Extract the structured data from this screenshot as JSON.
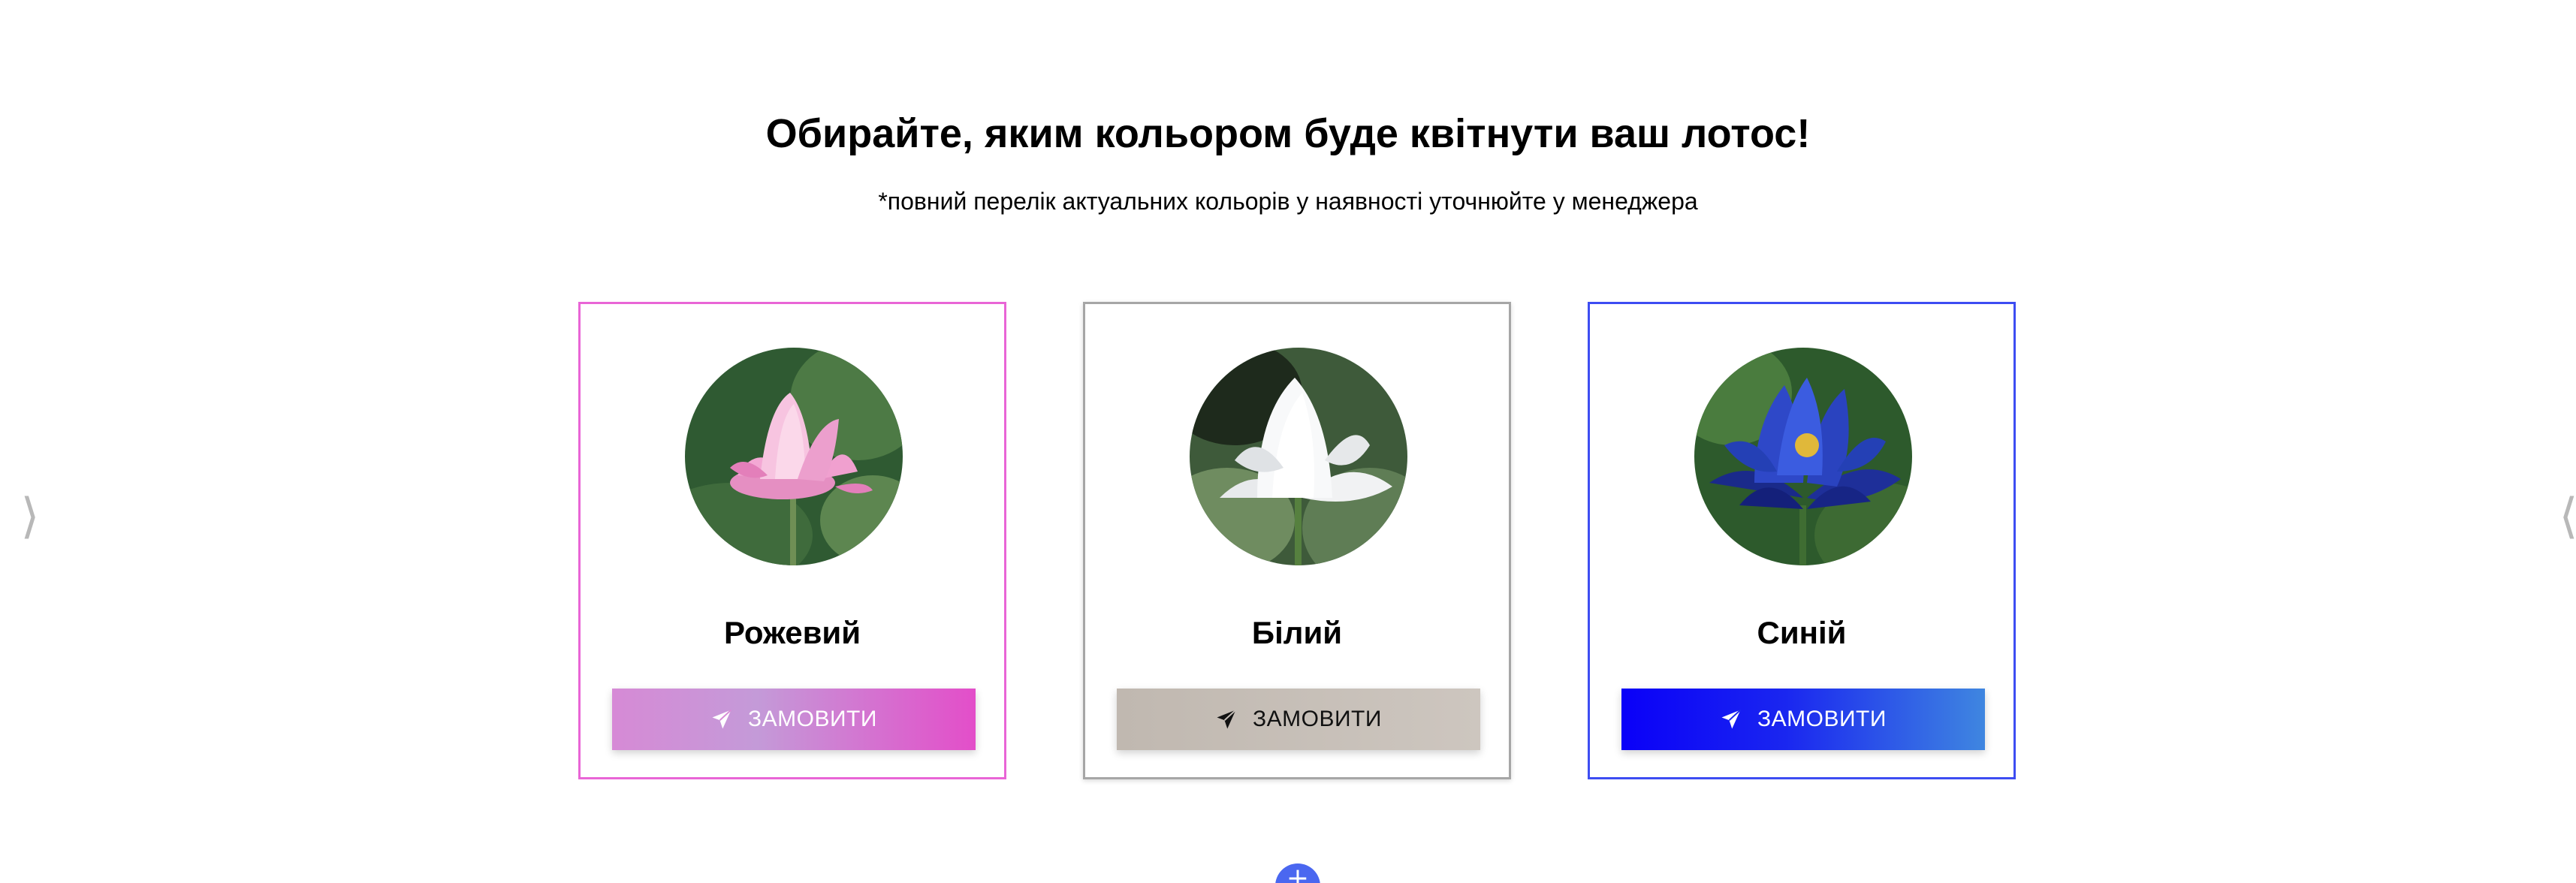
{
  "header": {
    "title": "Обирайте, яким кольором буде квітнути ваш лотос!",
    "subtitle": "*повний перелік актуальних кольорів у наявності уточнюйте у менеджера"
  },
  "carousel": {
    "prev_icon": "chevron-left-icon",
    "next_icon": "chevron-right-icon",
    "prev_glyph": "⟩",
    "next_glyph": "⟨"
  },
  "cards": [
    {
      "name": "Рожевий",
      "button_label": "ЗАМОВИТИ",
      "button_icon": "paper-plane-icon",
      "accent": "#e965d6"
    },
    {
      "name": "Білий",
      "button_label": "ЗАМОВИТИ",
      "button_icon": "paper-plane-icon",
      "accent": "#a6a6a6"
    },
    {
      "name": "Синій",
      "button_label": "ЗАМОВИТИ",
      "button_icon": "paper-plane-icon",
      "accent": "#3d4df2"
    }
  ],
  "fab": {
    "icon": "plus-icon",
    "color": "#4a67f0"
  }
}
